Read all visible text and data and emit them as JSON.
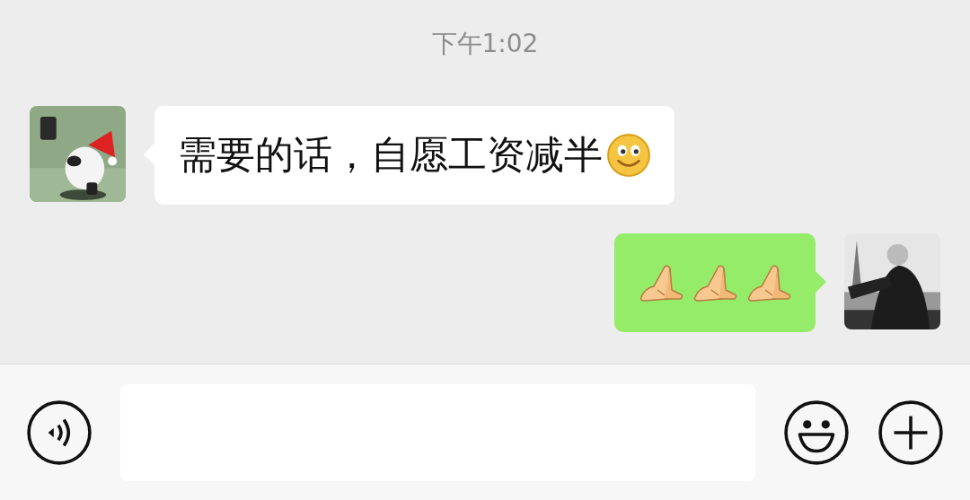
{
  "time": "下午1:02",
  "messages": [
    {
      "kind": "incoming",
      "text": "需要的话，自愿工资减半",
      "emojis": [
        {
          "kind": "smile"
        }
      ]
    },
    {
      "kind": "outgoing",
      "emojis": [
        {
          "kind": "hands"
        },
        {
          "kind": "hands"
        },
        {
          "kind": "hands"
        }
      ]
    }
  ]
}
